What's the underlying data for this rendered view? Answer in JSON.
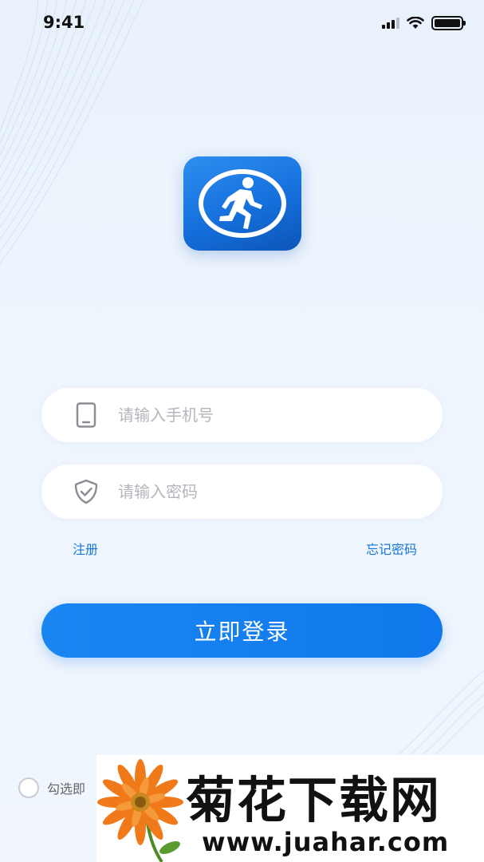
{
  "status_bar": {
    "time": "9:41",
    "battery_level": 1.0
  },
  "app": {
    "logo_icon": "running-man-icon",
    "accent_color": "#1677e8"
  },
  "login_form": {
    "phone": {
      "placeholder": "请输入手机号",
      "value": "",
      "icon": "phone-icon"
    },
    "password": {
      "placeholder": "请输入密码",
      "value": "",
      "icon": "shield-check-icon"
    },
    "register_label": "注册",
    "forgot_label": "忘记密码",
    "submit_label": "立即登录"
  },
  "agreement": {
    "checked": false,
    "text": "勾选即"
  },
  "watermark": {
    "title": "菊花下载网",
    "url": "www.juahar.com"
  }
}
